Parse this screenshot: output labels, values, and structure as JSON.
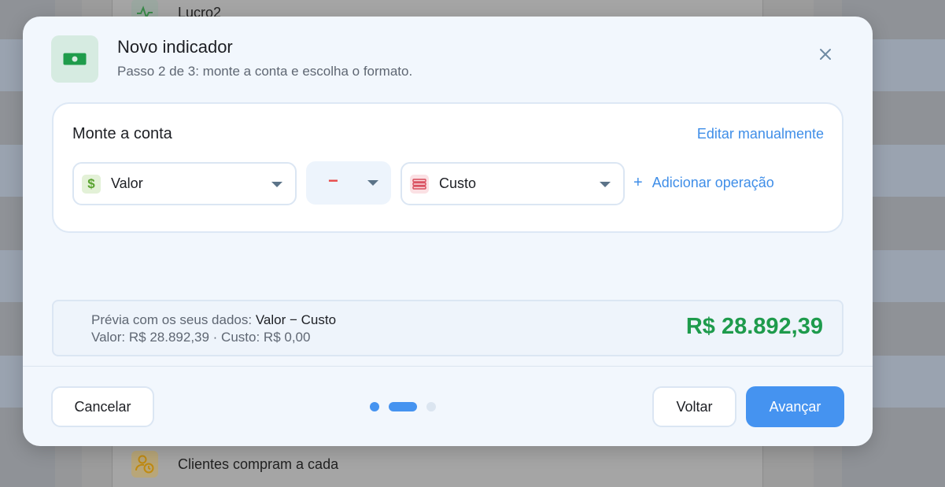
{
  "background": {
    "rows": [
      {
        "label": "Lucro2",
        "icon": "pulse-icon"
      },
      {
        "label": "Clientes compram a cada",
        "icon": "user-clock-icon"
      }
    ]
  },
  "modal": {
    "title": "Novo indicador",
    "subtitle": "Passo 2 de 3: monte a conta e escolha o formato.",
    "header_icon": "cash-icon",
    "close_icon": "close-icon"
  },
  "formula": {
    "title": "Monte a conta",
    "edit_link": "Editar manualmente",
    "operand1": {
      "label": "Valor",
      "icon_glyph": "$",
      "icon": "dollar-icon"
    },
    "operator": {
      "sign": "−"
    },
    "operand2": {
      "label": "Custo",
      "icon": "money-stack-icon"
    },
    "add_operation": "Adicionar operação",
    "add_symbol": "+"
  },
  "preview": {
    "label": "Prévia com os seus dados:",
    "expression": "Valor − Custo",
    "details": "Valor: R$ 28.892,39  ·  Custo: R$ 0,00",
    "total": "R$ 28.892,39"
  },
  "footer": {
    "cancel": "Cancelar",
    "back": "Voltar",
    "next": "Avançar",
    "current_step": 2,
    "total_steps": 3
  },
  "colors": {
    "accent": "#4593f0",
    "positive": "#1e9b4c",
    "minus": "#e84a4a"
  }
}
